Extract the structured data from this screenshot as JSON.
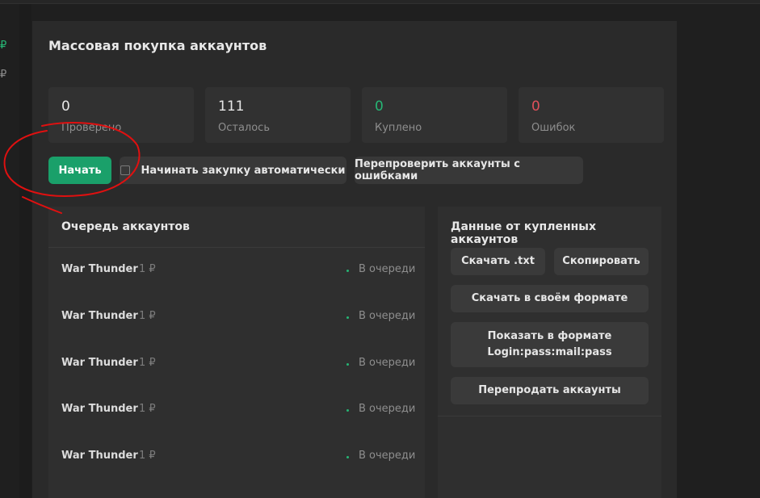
{
  "sidebar": {
    "icon_1": "₽",
    "icon_2": "₽"
  },
  "page": {
    "title": "Массовая покупка аккаунтов"
  },
  "stats": [
    {
      "value": "0",
      "label": "Проверено"
    },
    {
      "value": "111",
      "label": "Осталось"
    },
    {
      "value": "0",
      "label": "Куплено"
    },
    {
      "value": "0",
      "label": "Ошибок"
    }
  ],
  "actions": {
    "start": "Начать",
    "auto_start": "Начинать закупку автоматически",
    "recheck": "Перепроверить аккаунты с ошибками"
  },
  "queue": {
    "title": "Очередь аккаунтов",
    "items": [
      {
        "name": "War Thunder",
        "price": "1 ₽",
        "status": "В очереди"
      },
      {
        "name": "War Thunder",
        "price": "1 ₽",
        "status": "В очереди"
      },
      {
        "name": "War Thunder",
        "price": "1 ₽",
        "status": "В очереди"
      },
      {
        "name": "War Thunder",
        "price": "1 ₽",
        "status": "В очереди"
      },
      {
        "name": "War Thunder",
        "price": "1 ₽",
        "status": "В очереди"
      }
    ]
  },
  "purchased": {
    "title": "Данные от купленных аккаунтов",
    "download_txt": "Скачать .txt",
    "copy": "Скопировать",
    "download_custom": "Скачать в своём формате",
    "show_format_line1": "Показать в формате",
    "show_format_line2": "Login:pass:mail:pass",
    "resell": "Перепродать аккаунты"
  },
  "colors": {
    "accent_green": "#1aa06a",
    "success_text": "#26b574",
    "error_text": "#e0505a",
    "annotation_red": "#e01010"
  }
}
